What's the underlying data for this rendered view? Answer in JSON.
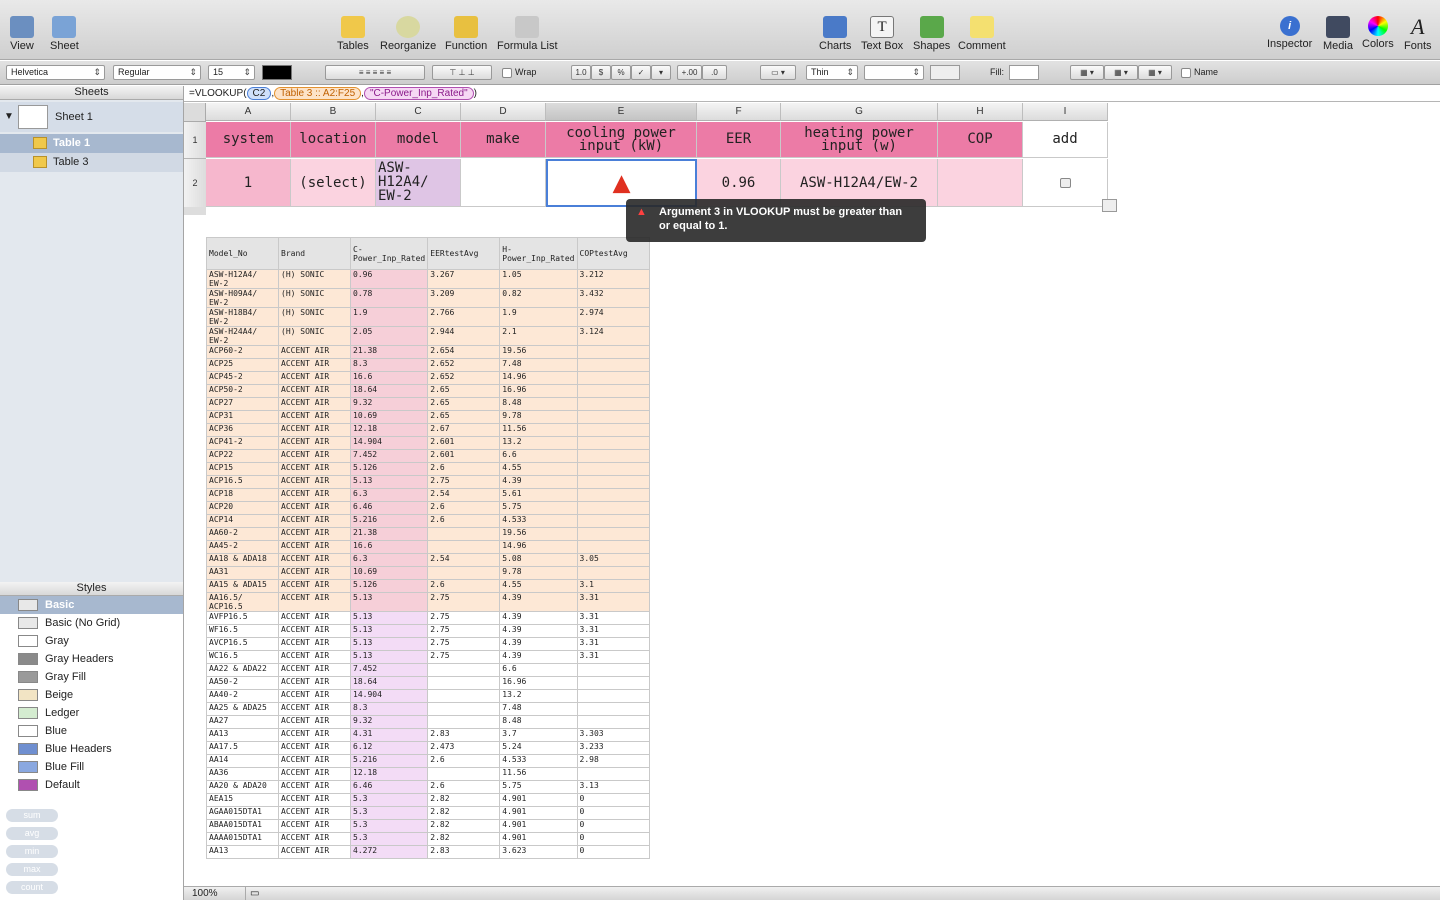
{
  "toolbar": {
    "left": [
      {
        "label": "View",
        "icon": "view-icon"
      },
      {
        "label": "Sheet",
        "icon": "sheet-icon"
      }
    ],
    "center": [
      {
        "label": "Tables",
        "icon": "tables-icon"
      },
      {
        "label": "Reorganize",
        "icon": "reorganize-icon"
      },
      {
        "label": "Function",
        "icon": "function-icon"
      },
      {
        "label": "Formula List",
        "icon": "formula-list-icon"
      }
    ],
    "insert": [
      {
        "label": "Charts",
        "icon": "charts-icon"
      },
      {
        "label": "Text Box",
        "icon": "text-box-icon"
      },
      {
        "label": "Shapes",
        "icon": "shapes-icon"
      },
      {
        "label": "Comment",
        "icon": "comment-icon"
      }
    ],
    "right": [
      {
        "label": "Inspector",
        "icon": "inspector-icon"
      },
      {
        "label": "Media",
        "icon": "media-icon"
      },
      {
        "label": "Colors",
        "icon": "colors-icon"
      },
      {
        "label": "Fonts",
        "icon": "fonts-icon"
      }
    ]
  },
  "format": {
    "font": "Helvetica",
    "style": "Regular",
    "size": "15",
    "wrap": "Wrap",
    "decimals1": "1.0",
    "currency": "$",
    "percent": "%",
    "check": "✓",
    "decimals2": "+.00",
    "decimals3": ".0",
    "stroke": "Thin",
    "fill": "Fill:",
    "name": "Name"
  },
  "formula": {
    "prefix": "=VLOOKUP(",
    "arg1": "C2",
    "arg2": "Table 3 :: A2:F25",
    "arg3": "\"C-Power_Inp_Rated\"",
    "suffix": ")"
  },
  "sidebar": {
    "sheets_title": "Sheets",
    "sheet": "Sheet 1",
    "tables": [
      "Table 1",
      "Table 3"
    ],
    "styles_title": "Styles",
    "styles": [
      {
        "name": "Basic",
        "swatch": "#e8e8e8"
      },
      {
        "name": "Basic (No Grid)",
        "swatch": "#e8e8e8"
      },
      {
        "name": "Gray",
        "swatch": "#ffffff"
      },
      {
        "name": "Gray Headers",
        "swatch": "#8a8a8a"
      },
      {
        "name": "Gray Fill",
        "swatch": "#9a9a9a"
      },
      {
        "name": "Beige",
        "swatch": "#f2e4c4"
      },
      {
        "name": "Ledger",
        "swatch": "#d4ecd0"
      },
      {
        "name": "Blue",
        "swatch": "#ffffff"
      },
      {
        "name": "Blue Headers",
        "swatch": "#6f8fd0"
      },
      {
        "name": "Blue Fill",
        "swatch": "#8aa8e0"
      },
      {
        "name": "Default",
        "swatch": "#b050b0"
      }
    ],
    "functions": [
      "sum",
      "avg",
      "min",
      "max",
      "count"
    ]
  },
  "table1": {
    "columns": [
      "A",
      "B",
      "C",
      "D",
      "E",
      "F",
      "G",
      "H",
      "I"
    ],
    "rows": [
      "1",
      "2"
    ],
    "headers": [
      "system",
      "location",
      "model",
      "make",
      "cooling power input (kW)",
      "EER",
      "heating power input (w)",
      "COP",
      "add"
    ],
    "values": [
      "1",
      "(select)",
      "ASW-H12A4/ EW-2",
      "",
      "",
      "0.96",
      "ASW-H12A4/EW-2",
      "",
      ""
    ]
  },
  "error": {
    "message": "Argument 3 in VLOOKUP must be greater than or equal to 1."
  },
  "table3": {
    "headers": [
      "Model_No",
      "Brand",
      "C-Power_Inp_Rated",
      "EERtestAvg",
      "H-Power_Inp_Rated",
      "COPtestAvg"
    ],
    "rows": [
      [
        "ASW-H12A4/ EW-2",
        "(H) SONIC",
        "0.96",
        "3.267",
        "1.05",
        "3.212"
      ],
      [
        "ASW-H09A4/ EW-2",
        "(H) SONIC",
        "0.78",
        "3.209",
        "0.82",
        "3.432"
      ],
      [
        "ASW-H18B4/ EW-2",
        "(H) SONIC",
        "1.9",
        "2.766",
        "1.9",
        "2.974"
      ],
      [
        "ASW-H24A4/ EW-2",
        "(H) SONIC",
        "2.05",
        "2.944",
        "2.1",
        "3.124"
      ],
      [
        "ACP60-2",
        "ACCENT AIR",
        "21.38",
        "2.654",
        "19.56",
        ""
      ],
      [
        "ACP25",
        "ACCENT AIR",
        "8.3",
        "2.652",
        "7.48",
        ""
      ],
      [
        "ACP45-2",
        "ACCENT AIR",
        "16.6",
        "2.652",
        "14.96",
        ""
      ],
      [
        "ACP50-2",
        "ACCENT AIR",
        "18.64",
        "2.65",
        "16.96",
        ""
      ],
      [
        "ACP27",
        "ACCENT AIR",
        "9.32",
        "2.65",
        "8.48",
        ""
      ],
      [
        "ACP31",
        "ACCENT AIR",
        "10.69",
        "2.65",
        "9.78",
        ""
      ],
      [
        "ACP36",
        "ACCENT AIR",
        "12.18",
        "2.67",
        "11.56",
        ""
      ],
      [
        "ACP41-2",
        "ACCENT AIR",
        "14.904",
        "2.601",
        "13.2",
        ""
      ],
      [
        "ACP22",
        "ACCENT AIR",
        "7.452",
        "2.601",
        "6.6",
        ""
      ],
      [
        "ACP15",
        "ACCENT AIR",
        "5.126",
        "2.6",
        "4.55",
        ""
      ],
      [
        "ACP16.5",
        "ACCENT AIR",
        "5.13",
        "2.75",
        "4.39",
        ""
      ],
      [
        "ACP18",
        "ACCENT AIR",
        "6.3",
        "2.54",
        "5.61",
        ""
      ],
      [
        "ACP20",
        "ACCENT AIR",
        "6.46",
        "2.6",
        "5.75",
        ""
      ],
      [
        "ACP14",
        "ACCENT AIR",
        "5.216",
        "2.6",
        "4.533",
        ""
      ],
      [
        "AA60-2",
        "ACCENT AIR",
        "21.38",
        "",
        "19.56",
        ""
      ],
      [
        "AA45-2",
        "ACCENT AIR",
        "16.6",
        "",
        "14.96",
        ""
      ],
      [
        "AA18 & ADA18",
        "ACCENT AIR",
        "6.3",
        "2.54",
        "5.08",
        "3.05"
      ],
      [
        "AA31",
        "ACCENT AIR",
        "10.69",
        "",
        "9.78",
        ""
      ],
      [
        "AA15 & ADA15",
        "ACCENT AIR",
        "5.126",
        "2.6",
        "4.55",
        "3.1"
      ],
      [
        "AA16.5/ ACP16.5",
        "ACCENT AIR",
        "5.13",
        "2.75",
        "4.39",
        "3.31"
      ],
      [
        "AVFP16.5",
        "ACCENT AIR",
        "5.13",
        "2.75",
        "4.39",
        "3.31"
      ],
      [
        "WF16.5",
        "ACCENT AIR",
        "5.13",
        "2.75",
        "4.39",
        "3.31"
      ],
      [
        "AVCP16.5",
        "ACCENT AIR",
        "5.13",
        "2.75",
        "4.39",
        "3.31"
      ],
      [
        "WC16.5",
        "ACCENT AIR",
        "5.13",
        "2.75",
        "4.39",
        "3.31"
      ],
      [
        "AA22 & ADA22",
        "ACCENT AIR",
        "7.452",
        "",
        "6.6",
        ""
      ],
      [
        "AA50-2",
        "ACCENT AIR",
        "18.64",
        "",
        "16.96",
        ""
      ],
      [
        "AA40-2",
        "ACCENT AIR",
        "14.904",
        "",
        "13.2",
        ""
      ],
      [
        "AA25 & ADA25",
        "ACCENT AIR",
        "8.3",
        "",
        "7.48",
        ""
      ],
      [
        "AA27",
        "ACCENT AIR",
        "9.32",
        "",
        "8.48",
        ""
      ],
      [
        "AA13",
        "ACCENT AIR",
        "4.31",
        "2.83",
        "3.7",
        "3.303"
      ],
      [
        "AA17.5",
        "ACCENT AIR",
        "6.12",
        "2.473",
        "5.24",
        "3.233"
      ],
      [
        "AA14",
        "ACCENT AIR",
        "5.216",
        "2.6",
        "4.533",
        "2.98"
      ],
      [
        "AA36",
        "ACCENT AIR",
        "12.18",
        "",
        "11.56",
        ""
      ],
      [
        "AA20 & ADA20",
        "ACCENT AIR",
        "6.46",
        "2.6",
        "5.75",
        "3.13"
      ],
      [
        "AEA15",
        "ACCENT AIR",
        "5.3",
        "2.82",
        "4.901",
        "0"
      ],
      [
        "AGAA015DTA1",
        "ACCENT AIR",
        "5.3",
        "2.82",
        "4.901",
        "0"
      ],
      [
        "ABAA015DTA1",
        "ACCENT AIR",
        "5.3",
        "2.82",
        "4.901",
        "0"
      ],
      [
        "AAAA015DTA1",
        "ACCENT AIR",
        "5.3",
        "2.82",
        "4.901",
        "0"
      ],
      [
        "AA13",
        "ACCENT AIR",
        "4.272",
        "2.83",
        "3.623",
        "0"
      ]
    ]
  },
  "status": {
    "zoom": "100%"
  }
}
